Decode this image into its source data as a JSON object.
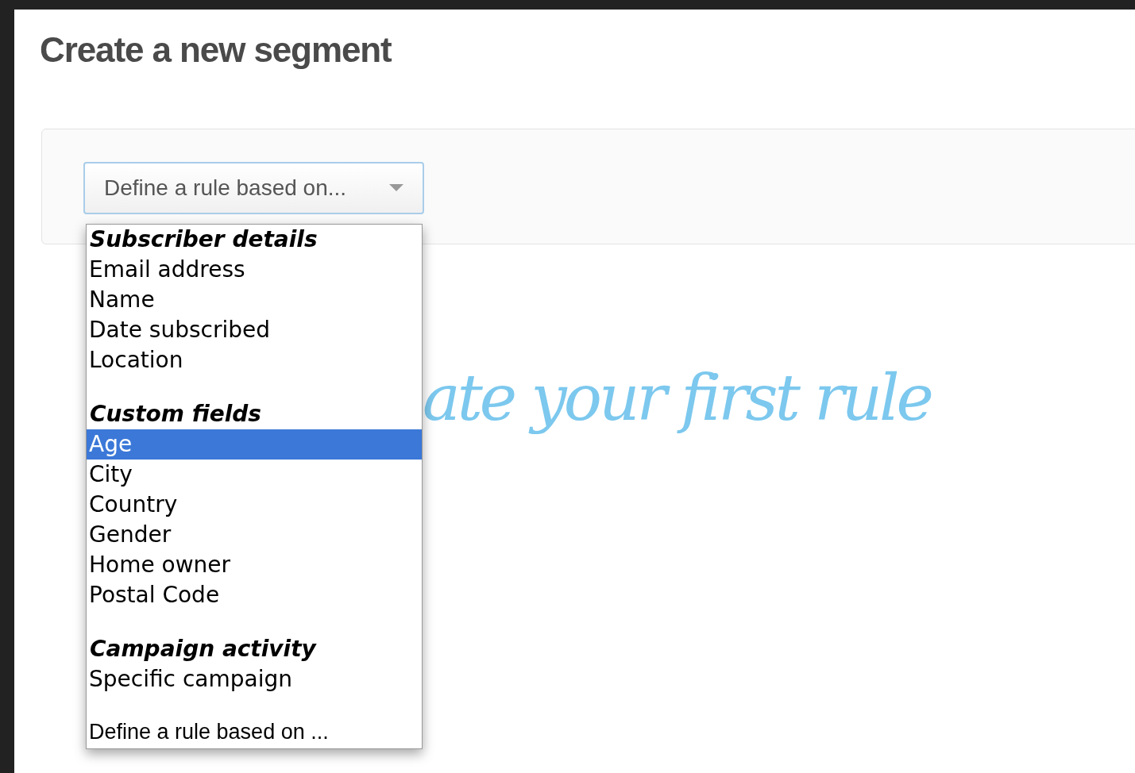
{
  "page_title": "Create a new segment",
  "rule_select": {
    "label": "Define a rule based on..."
  },
  "hint": "ate your first rule",
  "menu": {
    "groups": [
      {
        "label": "Subscriber details",
        "options": [
          {
            "label": "Email address",
            "selected": false
          },
          {
            "label": "Name",
            "selected": false
          },
          {
            "label": "Date subscribed",
            "selected": false
          },
          {
            "label": "Location",
            "selected": false
          }
        ]
      },
      {
        "label": "Custom fields",
        "options": [
          {
            "label": "Age",
            "selected": true
          },
          {
            "label": "City",
            "selected": false
          },
          {
            "label": "Country",
            "selected": false
          },
          {
            "label": "Gender",
            "selected": false
          },
          {
            "label": "Home owner",
            "selected": false
          },
          {
            "label": "Postal Code",
            "selected": false
          }
        ]
      },
      {
        "label": "Campaign activity",
        "options": [
          {
            "label": "Specific campaign",
            "selected": false
          }
        ]
      }
    ],
    "placeholder_option": {
      "label": "Define a rule based on ...",
      "selected": false
    }
  }
}
